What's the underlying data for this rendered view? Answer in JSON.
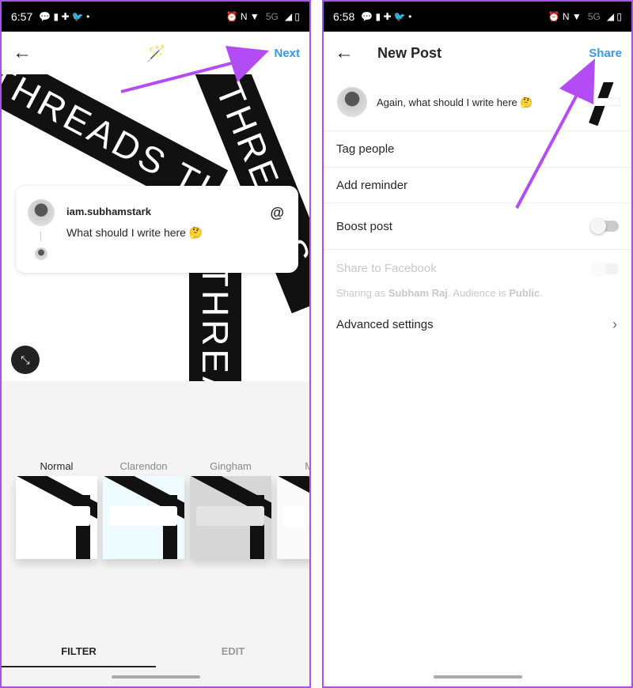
{
  "left": {
    "status": {
      "time": "6:57",
      "network": "5G"
    },
    "header": {
      "next_label": "Next"
    },
    "post_card": {
      "username": "iam.subhamstark",
      "text": "What should I write here 🤔"
    },
    "image_text": {
      "band1": "THREADS THR",
      "band2": "S THREADS",
      "band3": "DS THREADS TH"
    },
    "filters": [
      "Normal",
      "Clarendon",
      "Gingham",
      "Moon"
    ],
    "selected_filter": "Normal",
    "tabs": {
      "filter": "FILTER",
      "edit": "EDIT"
    },
    "active_tab": "FILTER"
  },
  "right": {
    "status": {
      "time": "6:58",
      "network": "5G"
    },
    "header": {
      "title": "New Post",
      "share_label": "Share"
    },
    "caption": "Again, what should I write here 🤔",
    "rows": {
      "tag_people": "Tag people",
      "add_reminder": "Add reminder",
      "boost_post": "Boost post",
      "share_facebook": "Share to Facebook",
      "advanced": "Advanced settings"
    },
    "boost_enabled": false,
    "sharing": {
      "prefix": "Sharing as ",
      "name": "Subham Raj",
      "mid": ". Audience is ",
      "audience": "Public",
      "end": "."
    }
  },
  "colors": {
    "accent": "#3897f0",
    "annotation_arrow": "#b44cf6",
    "border": "#a654e6"
  }
}
